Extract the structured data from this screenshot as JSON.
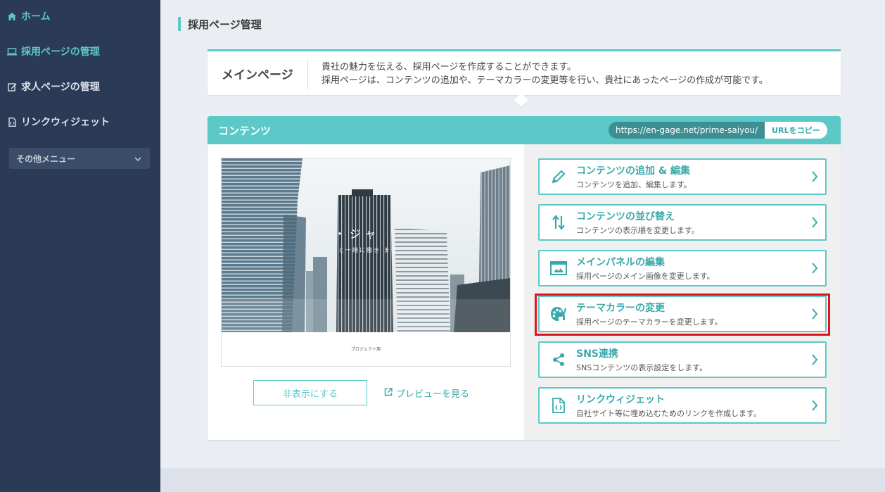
{
  "sidebar": {
    "items": [
      {
        "label": "ホーム",
        "icon": "home-icon"
      },
      {
        "label": "採用ページの管理",
        "icon": "monitor-icon"
      },
      {
        "label": "求人ページの管理",
        "icon": "edit-icon"
      },
      {
        "label": "リンクウィジェット",
        "icon": "file-code-icon"
      }
    ],
    "other_menu": "その他メニュー"
  },
  "page_title": "採用ページ管理",
  "main_page": {
    "title": "メインページ",
    "desc_line1": "貴社の魅力を伝える、採用ページを作成することができます。",
    "desc_line2": "採用ページは、コンテンツの追加や、テーマカラーの変更等を行い、貴社にあったページの作成が可能です。"
  },
  "content": {
    "title": "コンテンツ",
    "url": "https://en-gage.net/prime-saiyou/",
    "copy_label": "URLをコピー",
    "preview": {
      "overlay_title": "・ジャ",
      "overlay_sub": "と一緒に働き ませ",
      "caption": "プロジェクト用"
    },
    "hide_button": "非表示にする",
    "preview_link": "プレビューを見る"
  },
  "cards": [
    {
      "title": "コンテンツの追加 & 編集",
      "desc": "コンテンツを追加、編集します。",
      "icon": "pencil-icon"
    },
    {
      "title": "コンテンツの並び替え",
      "desc": "コンテンツの表示順を変更します。",
      "icon": "sort-arrows-icon"
    },
    {
      "title": "メインパネルの編集",
      "desc": "採用ページのメイン画像を変更します。",
      "icon": "panel-icon"
    },
    {
      "title": "テーマカラーの変更",
      "desc": "採用ページのテーマカラーを変更します。",
      "icon": "palette-icon"
    },
    {
      "title": "SNS連携",
      "desc": "SNSコンテンツの表示設定をします。",
      "icon": "share-icon"
    },
    {
      "title": "リンクウィジェット",
      "desc": "自社サイト等に埋め込むためのリンクを作成します。",
      "icon": "file-code-icon"
    }
  ],
  "colors": {
    "sidebar": "#2b3a55",
    "accent": "#5cc8c8",
    "highlight": "#e0141c"
  }
}
